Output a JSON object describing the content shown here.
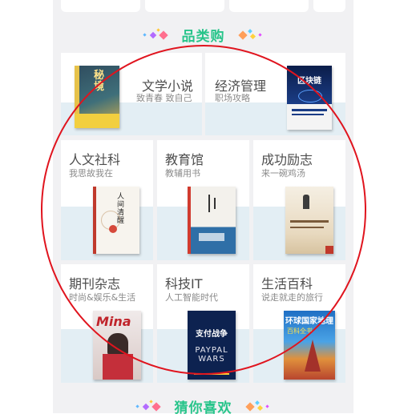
{
  "section_header": {
    "title": "品类购"
  },
  "footer_header": {
    "title": "猜你喜欢"
  },
  "categories": [
    {
      "title": "文学小说",
      "subtitle": "致青春 致自己"
    },
    {
      "title": "经济管理",
      "subtitle": "职场攻略"
    },
    {
      "title": "人文社科",
      "subtitle": "我思故我在"
    },
    {
      "title": "教育馆",
      "subtitle": "教辅用书"
    },
    {
      "title": "成功励志",
      "subtitle": "来一碗鸡汤"
    },
    {
      "title": "期刊杂志",
      "subtitle": "时尚&娱乐&生活"
    },
    {
      "title": "科技IT",
      "subtitle": "人工智能时代"
    },
    {
      "title": "生活百科",
      "subtitle": "说走就走的旅行"
    }
  ],
  "book_covers": {
    "literature": "秘境",
    "economics": "区块链",
    "humanities": "人间清醒",
    "tech": "支付战争",
    "tech_en": "PAYPAL WARS",
    "life": "环球国家地理",
    "life_sub": "百科全书"
  },
  "colors": {
    "accent": "#27c48a",
    "annotation_circle": "#e0141e",
    "tile_band": "#e3eef4"
  }
}
